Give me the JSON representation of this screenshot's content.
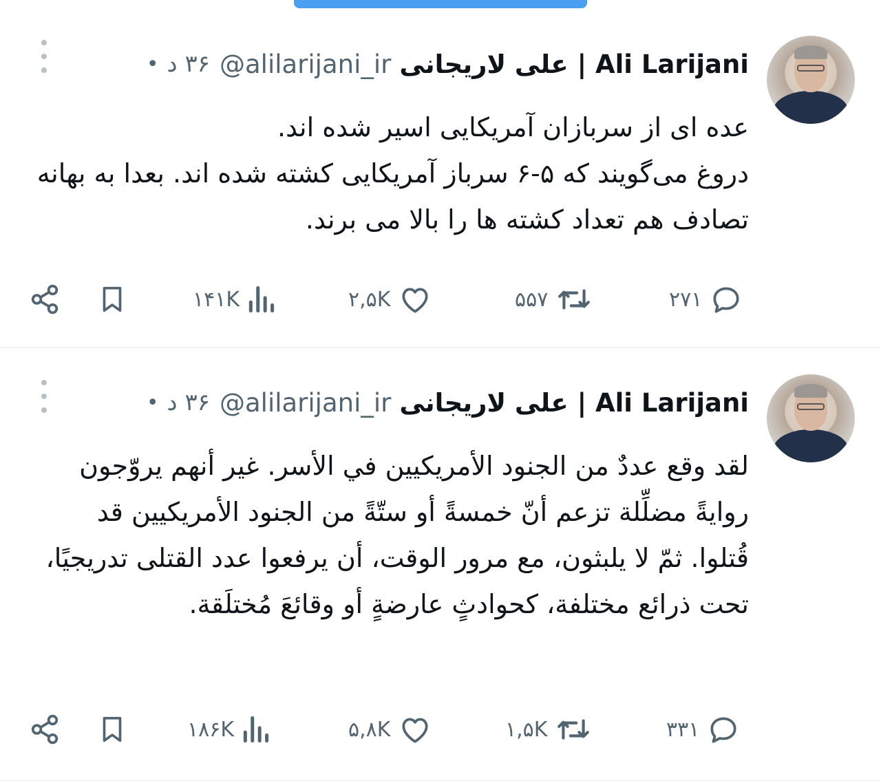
{
  "colors": {
    "accent": "#4a9ff0",
    "text": "#0f1419",
    "muted": "#536471",
    "divider": "#eff3f4"
  },
  "tweets": [
    {
      "author": {
        "display_name": "علی لاریجانی | Ali Larijani",
        "handle": "@alilarijani_ir",
        "time": "۳۶ د",
        "separator": "•"
      },
      "text": "عده ای از سربازان آمریکایی اسیر شده اند.\nدروغ می‌گویند که ۵-۶ سرباز آمریکایی کشته شده اند. بعدا به بهانه تصادف هم تعداد کشته ها را بالا می برند.",
      "stats": {
        "replies": "۲۷۱",
        "reposts": "۵۵۷",
        "likes": "۲,۵K",
        "views": "۱۴۱K"
      },
      "icons": [
        "reply-icon",
        "repost-icon",
        "like-icon",
        "views-icon",
        "bookmark-icon",
        "share-icon",
        "more-icon"
      ]
    },
    {
      "author": {
        "display_name": "علی لاریجانی | Ali Larijani",
        "handle": "@alilarijani_ir",
        "time": "۳۶ د",
        "separator": "•"
      },
      "text": "لقد وقع عددٌ من الجنود الأمريكيين في الأسر. غير أنهم يروّجون روايةً مضلِّلة تزعم أنّ خمسةً أو ستّةً من الجنود الأمريكيين قد قُتلوا. ثمّ لا يلبثون، مع مرور الوقت، أن يرفعوا عدد القتلى تدريجيًا، تحت ذرائع مختلفة، كحوادثٍ عارضةٍ أو وقائعَ مُختلَقة.",
      "stats": {
        "replies": "۳۳۱",
        "reposts": "۱,۵K",
        "likes": "۵,۸K",
        "views": "۱۸۶K"
      },
      "icons": [
        "reply-icon",
        "repost-icon",
        "like-icon",
        "views-icon",
        "bookmark-icon",
        "share-icon",
        "more-icon"
      ]
    }
  ]
}
